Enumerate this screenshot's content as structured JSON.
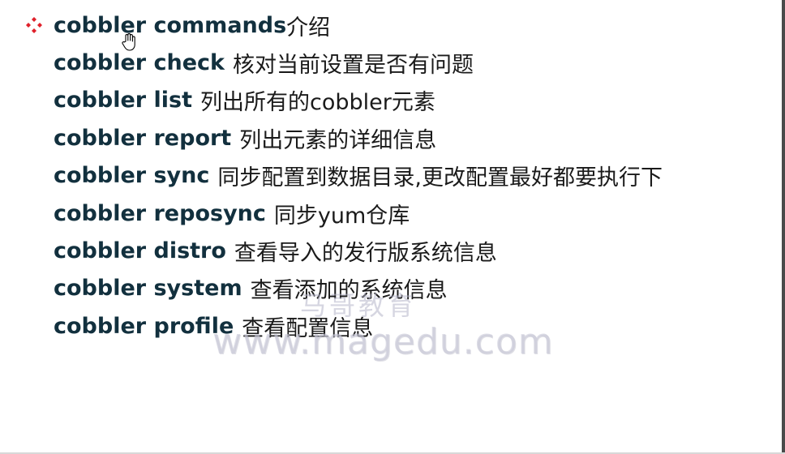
{
  "slide": {
    "heading": {
      "command": "cobbler commands",
      "description": "介绍"
    },
    "items": [
      {
        "command": "cobbler check",
        "description": "核对当前设置是否有问题"
      },
      {
        "command": "cobbler list",
        "description": "列出所有的cobbler元素"
      },
      {
        "command": "cobbler report",
        "description": "列出元素的详细信息"
      },
      {
        "command": "cobbler sync",
        "description": "同步配置到数据目录,更改配置最好都要执行下"
      },
      {
        "command": "cobbler reposync",
        "description": "同步yum仓库"
      },
      {
        "command": "cobbler distro",
        "description": "查看导入的发行版系统信息"
      },
      {
        "command": "cobbler system",
        "description": "查看添加的系统信息"
      },
      {
        "command": "cobbler profile",
        "description": "查看配置信息"
      }
    ],
    "bullet_icon": "four-diamond-bullet-icon",
    "bullet_color": "#e0202a",
    "text_color": "#12303e"
  },
  "watermark": {
    "chinese": "马哥教育",
    "url": "www.magedu.com"
  },
  "cursor_icon": "hand-cursor-icon"
}
